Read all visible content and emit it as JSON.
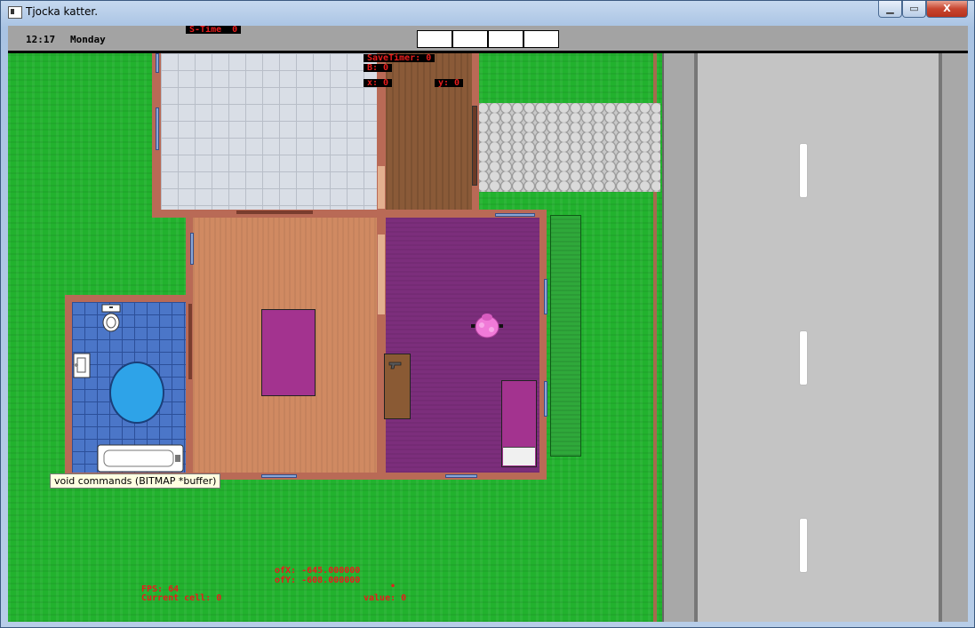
{
  "window": {
    "title": "Tjocka katter.",
    "controls": {
      "minimize": "▁",
      "maximize": "▭",
      "close": "X"
    }
  },
  "hud": {
    "clock": "12:17",
    "day": "Monday",
    "s_time": "S-Time  0",
    "save_timer": "SaveTimer: 0",
    "b_value": "B: 0",
    "x_label": "x: 0",
    "y_label": "y: 0",
    "inventory_slots": [
      "",
      "",
      "",
      ""
    ]
  },
  "tooltip": "void commands (BITMAP *buffer)",
  "debug": {
    "ofx": "ofX: -645.000000",
    "ofy": "ofY: -608.000000",
    "fps": "FPS: 64",
    "current_cell": "Current cell: 0",
    "value": "value: 0",
    "marker": "•"
  },
  "colors": {
    "grass": "#22b22e",
    "road": "#c4c4c4",
    "hud_text": "#e81c1c",
    "bedroom_floor": "#7c2e7c"
  }
}
